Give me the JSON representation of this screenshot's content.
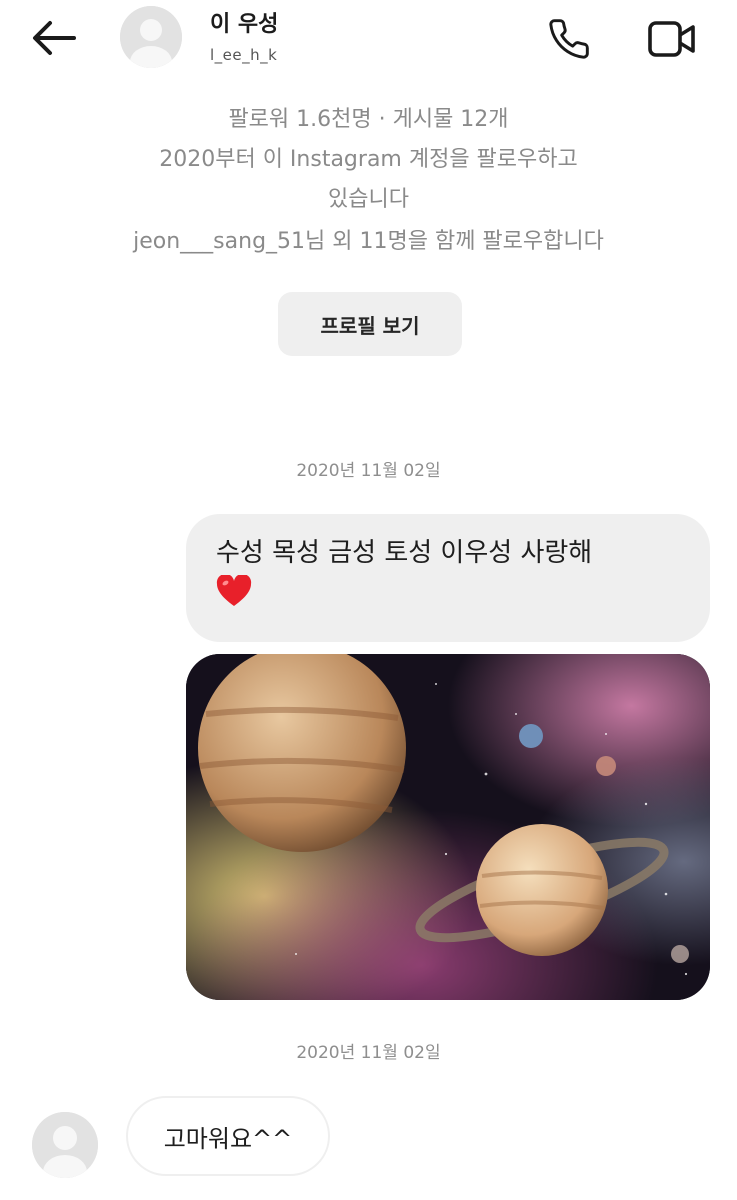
{
  "header": {
    "name": "이 우성",
    "username": "l_ee_h_k",
    "icons": {
      "back": "arrow-left-icon",
      "call": "phone-icon",
      "video": "video-camera-icon",
      "avatar": "default-avatar-icon"
    }
  },
  "profile": {
    "stats": "팔로워 1.6천명 · 게시물 12개",
    "following_line1": "2020부터 이 Instagram 계정을 팔로우하고",
    "following_line2": "있습니다",
    "mutual": "jeon___sang_51님 외 11명을 함께 팔로우합니다",
    "view_profile_label": "프로필 보기"
  },
  "messages": {
    "date_1": "2020년 11월 02일",
    "sent_text": "수성 목성 금성 토성 이우성 사랑해",
    "sent_emoji": "heart-emoji",
    "image_icon": "planets-space-image",
    "date_2": "2020년 11월 02일",
    "received_text": "고마워요^^"
  },
  "colors": {
    "bubble_gray": "#efefef",
    "secondary_text": "#8a8a8a",
    "heart": "#e8202a"
  }
}
